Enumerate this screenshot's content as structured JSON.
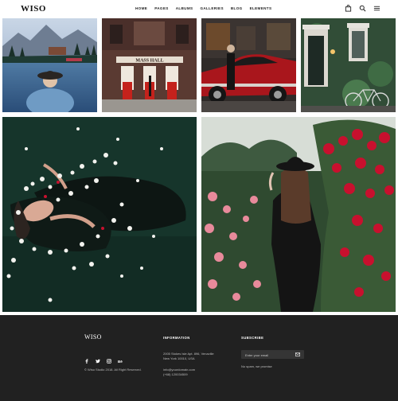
{
  "brand": {
    "logo": "WISO"
  },
  "nav": {
    "items": [
      "HOME",
      "PAGES",
      "ALBUMS",
      "GALLERIES",
      "BLOG",
      "ELEMENTS"
    ]
  },
  "header_icons": [
    "bag-icon",
    "search-icon",
    "menu-icon"
  ],
  "photos": [
    {
      "name": "photo-lake-mountain",
      "icon": "photo"
    },
    {
      "name": "photo-music-hall",
      "icon": "photo"
    },
    {
      "name": "photo-red-car",
      "icon": "photo"
    },
    {
      "name": "photo-green-house-bicycle",
      "icon": "photo"
    },
    {
      "name": "photo-woman-flowers-water",
      "icon": "photo"
    },
    {
      "name": "photo-woman-roses",
      "icon": "photo"
    }
  ],
  "footer": {
    "logo": "WISO",
    "social_icons": [
      "facebook-icon",
      "twitter-icon",
      "instagram-icon",
      "behance-icon"
    ],
    "copyright": "© Wiso Studio 2018. All Right Reserved.",
    "information": {
      "heading": "INFORMATION",
      "address_line1": "2005 Stokes Isle Apt. 896, Venaville",
      "address_line2": "New York 10010, USA",
      "email": "info@yourdomain.com",
      "phone": "(+68) 120034509"
    },
    "subscribe": {
      "heading": "SUBSCRIBE",
      "placeholder": "Enter your email",
      "note": "No spam, we promise"
    }
  },
  "colors": {
    "footer_bg": "#212121",
    "input_bg": "#353535",
    "accent_red": "#c8102e"
  }
}
